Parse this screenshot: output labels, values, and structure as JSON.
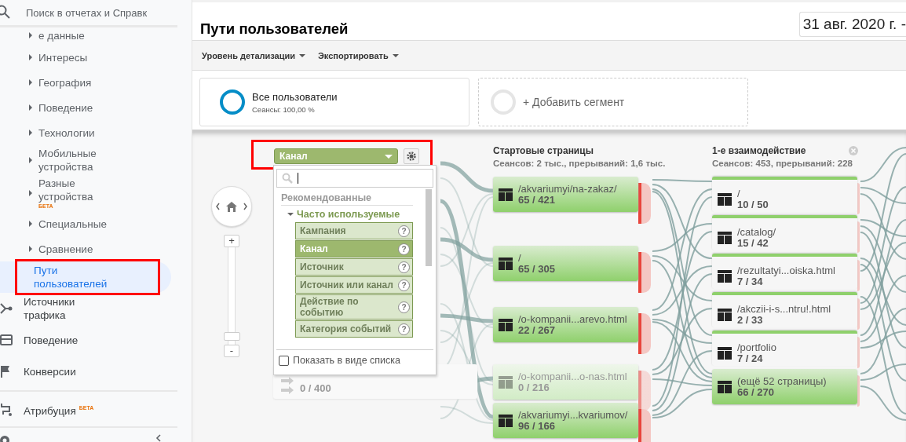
{
  "sidebar": {
    "search": {
      "placeholder": "Поиск в отчетах и Справк"
    },
    "items": [
      {
        "label": "е данные",
        "has_children": true,
        "selected": false
      },
      {
        "label": "Интересы",
        "has_children": true,
        "selected": false
      },
      {
        "label": "География",
        "has_children": true,
        "selected": false
      },
      {
        "label": "Поведение",
        "has_children": true,
        "selected": false
      },
      {
        "label": "Технологии",
        "has_children": true,
        "selected": false
      },
      {
        "label": "Мобильные устройства",
        "has_children": true,
        "selected": false
      },
      {
        "label": "Разные устройства",
        "badge": "БЕТА",
        "has_children": true,
        "selected": false
      },
      {
        "label": "Специальные",
        "has_children": true,
        "selected": false
      },
      {
        "label": "Сравнение",
        "has_children": true,
        "selected": false
      },
      {
        "label": "Пути пользователей",
        "has_children": false,
        "selected": true
      }
    ],
    "sections": [
      {
        "label": "Источники трафика",
        "kind": "traffic"
      },
      {
        "label": "Поведение",
        "kind": "behavior"
      },
      {
        "label": "Конверсии",
        "kind": "conversions"
      },
      {
        "label": "Атрибуция",
        "badge": "БЕТА",
        "kind": "attribution"
      }
    ]
  },
  "header": {
    "title": "Пути пользователей",
    "date_range": "31 авг. 2020 г. -"
  },
  "toolbar": [
    "Уровень детализации",
    "Экспортировать"
  ],
  "segments": [
    {
      "kind": "active",
      "name": "Все пользователи",
      "detail": "Сеансы: 100,00 %"
    },
    {
      "kind": "add",
      "name": "+ Добавить сегмент"
    }
  ],
  "flow": {
    "zoom": {
      "in_label": "+",
      "out_label": "-",
      "level": 0.05
    },
    "source_node": {
      "counts": "0 / 400"
    },
    "dimension_picker": {
      "value": "Канал",
      "group": "Рекомендованные",
      "subgroup": {
        "label": "Часто используемые",
        "expanded": true
      },
      "options": [
        {
          "label": "Кампания",
          "help": "?",
          "selected": false
        },
        {
          "label": "Канал",
          "help": "?",
          "selected": true
        },
        {
          "label": "Источник",
          "help": "?",
          "selected": false
        },
        {
          "label": "Источник или канал",
          "help": "?",
          "selected": false
        },
        {
          "label": "Действие по событию",
          "help": "?",
          "selected": false
        },
        {
          "label": "Категория событий",
          "help": "?",
          "selected": false
        }
      ],
      "list_toggle": {
        "label": "Показать в виде списка",
        "checked": false
      }
    },
    "columns": [
      {
        "title": "Стартовые страницы",
        "summary": "Сеансов: 2 тыс., прерываний: 1,6 тыс.",
        "closable": false,
        "nodes": [
          {
            "label": "/akvariumyi/na-zakaz/",
            "counts": "65 / 421",
            "highlighted": true,
            "dimmed": false
          },
          {
            "label": "/",
            "counts": "65 / 305",
            "highlighted": true,
            "dimmed": false
          },
          {
            "label": "/o-kompanii...arevo.html",
            "counts": "22 / 267",
            "highlighted": true,
            "dimmed": false
          },
          {
            "label": "/o-kompanii...o-nas.html",
            "counts": "0 / 216",
            "highlighted": true,
            "dimmed": true
          },
          {
            "label": "/akvariumyi...kvariumov/",
            "counts": "96 / 166",
            "highlighted": true,
            "dimmed": false
          }
        ]
      },
      {
        "title": "1-е взаимодействие",
        "summary": "Сеансов: 453, прерываний: 228",
        "closable": true,
        "nodes": [
          {
            "label": "/",
            "counts": "10 / 50",
            "highlighted": false,
            "dimmed": false
          },
          {
            "label": "/catalog/",
            "counts": "15 / 42",
            "highlighted": false,
            "dimmed": false
          },
          {
            "label": "/rezultatyi...oiska.html",
            "counts": "7 / 34",
            "highlighted": false,
            "dimmed": false
          },
          {
            "label": "/akczii-i-s...ntru!.html",
            "counts": "2 / 33",
            "highlighted": false,
            "dimmed": false
          },
          {
            "label": "/portfolio",
            "counts": "7 / 24",
            "highlighted": false,
            "dimmed": false
          },
          {
            "label": "(ещё 52 страницы)",
            "counts": "66 / 270",
            "highlighted": true,
            "dimmed": false
          }
        ]
      }
    ]
  }
}
